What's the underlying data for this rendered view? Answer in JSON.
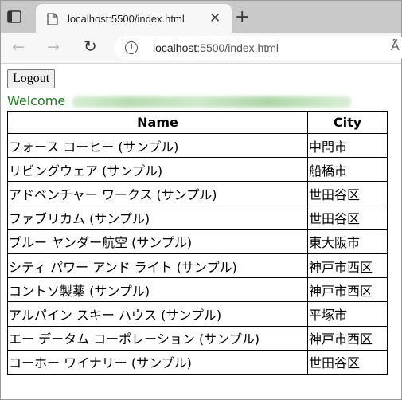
{
  "browser": {
    "tab_title": "localhost:5500/index.html",
    "tab_close": "✕",
    "new_tab": "+",
    "url_host": "localhost",
    "url_path": ":5500/index.html",
    "reader_label": "Ã"
  },
  "page": {
    "logout_label": "Logout",
    "welcome_label": "Welcome",
    "welcome_color": "#1d7a1d"
  },
  "table": {
    "headers": [
      "Name",
      "City"
    ],
    "rows": [
      [
        "フォース コーヒー (サンプル)",
        "中間市"
      ],
      [
        "リビングウェア (サンプル)",
        "船橋市"
      ],
      [
        "アドベンチャー ワークス (サンプル)",
        "世田谷区"
      ],
      [
        "ファブリカム (サンプル)",
        "世田谷区"
      ],
      [
        "ブルー ヤンダー航空 (サンプル)",
        "東大阪市"
      ],
      [
        "シティ パワー アンド ライト (サンプル)",
        "神戸市西区"
      ],
      [
        "コントソ製薬 (サンプル)",
        "神戸市西区"
      ],
      [
        "アルパイン スキー ハウス (サンプル)",
        "平塚市"
      ],
      [
        "エー データム コーポレーション (サンプル)",
        "神戸市西区"
      ],
      [
        "コーホー ワイナリー (サンプル)",
        "世田谷区"
      ]
    ]
  }
}
